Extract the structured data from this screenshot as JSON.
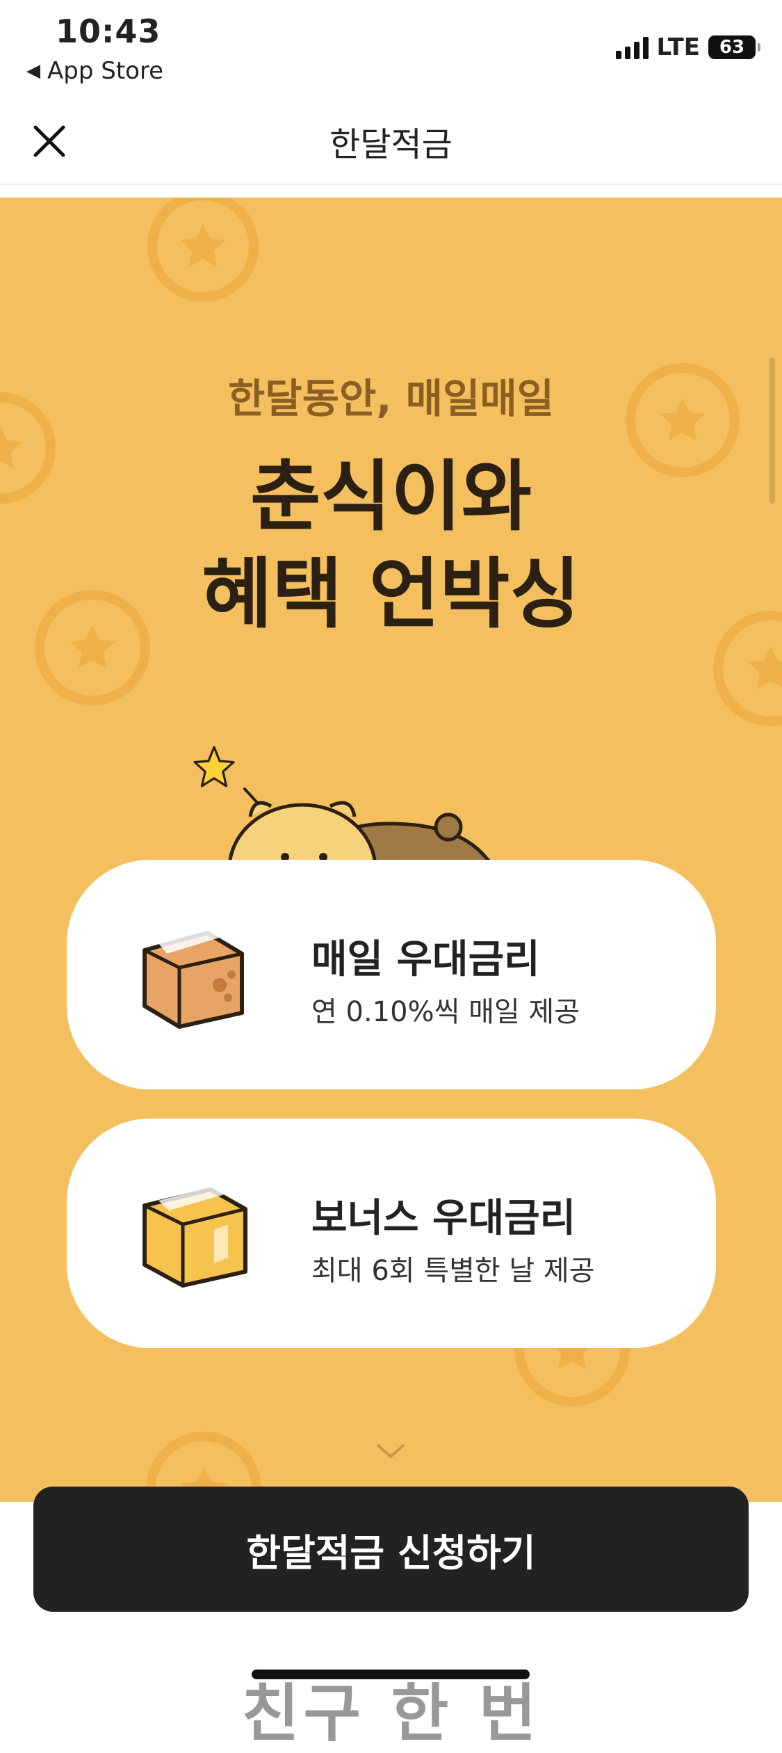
{
  "status_bar": {
    "time": "10:43",
    "back_app": "App Store",
    "network": "LTE",
    "battery": "63"
  },
  "nav": {
    "title": "한달적금",
    "close_icon": "close-icon"
  },
  "hero": {
    "eyebrow": "한달동안, 매일매일",
    "headline_line1": "춘식이와",
    "headline_line2": "혜택 언박싱"
  },
  "benefits": [
    {
      "title": "매일 우대금리",
      "desc": "연 0.10%씩 매일 제공",
      "icon": "brown-box-icon"
    },
    {
      "title": "보너스 우대금리",
      "desc": "최대 6회 특별한 날 제공",
      "icon": "gold-box-icon"
    }
  ],
  "cta": {
    "label": "한달적금 신청하기"
  },
  "peek_text": "친구 한 번",
  "colors": {
    "hero_bg": "#f4bf5e",
    "coin": "#eeb14a",
    "cta_bg": "#222222",
    "eyebrow": "#8a5f21"
  }
}
